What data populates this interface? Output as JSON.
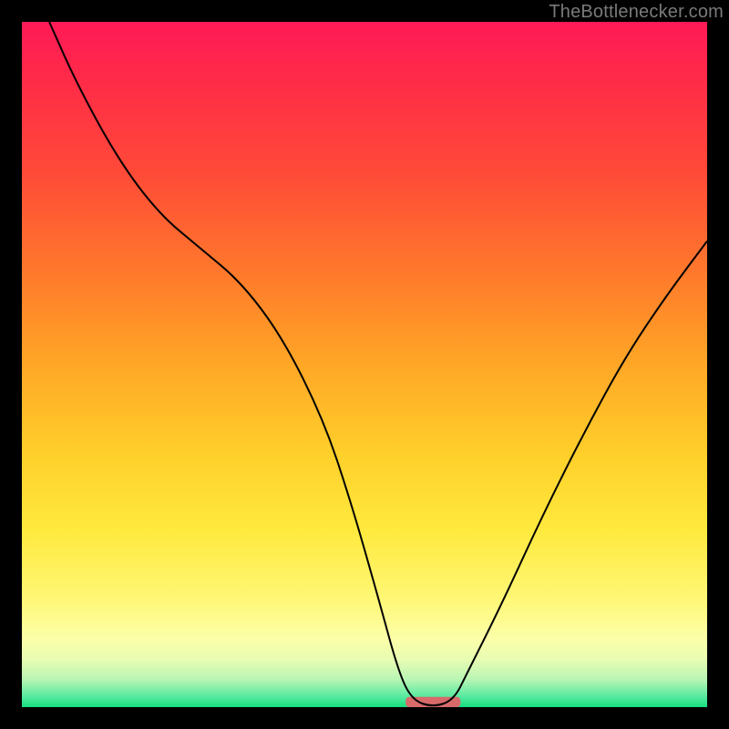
{
  "watermark": {
    "text": "TheBottlenecker.com"
  },
  "chart_data": {
    "type": "line",
    "title": "",
    "xlabel": "",
    "ylabel": "",
    "xlim": [
      0,
      100
    ],
    "ylim": [
      0,
      100
    ],
    "grid": false,
    "legend": false,
    "series": [
      {
        "name": "curve",
        "x": [
          4,
          8,
          14,
          20,
          26,
          32,
          38,
          44,
          48,
          52,
          55,
          57,
          60,
          63,
          65,
          70,
          76,
          82,
          88,
          94,
          100
        ],
        "y": [
          100,
          91,
          80,
          72,
          67,
          62,
          54,
          42,
          30,
          16,
          5,
          1,
          0,
          1,
          5,
          15,
          28,
          40,
          51,
          60,
          68
        ],
        "stroke": "#000000",
        "stroke_width": 2
      }
    ],
    "marker": {
      "name": "min-bar",
      "x_center": 60,
      "y": 0,
      "width_frac": 8,
      "height_frac": 1.5,
      "fill": "#d86a6a",
      "rx": 4
    },
    "background_gradient": [
      {
        "stop": 0.0,
        "color": "#ff1a57"
      },
      {
        "stop": 0.22,
        "color": "#ff4a38"
      },
      {
        "stop": 0.5,
        "color": "#ffa726"
      },
      {
        "stop": 0.74,
        "color": "#ffe93d"
      },
      {
        "stop": 0.9,
        "color": "#fcffa8"
      },
      {
        "stop": 0.96,
        "color": "#b8f5b4"
      },
      {
        "stop": 1.0,
        "color": "#16e07e"
      }
    ]
  }
}
